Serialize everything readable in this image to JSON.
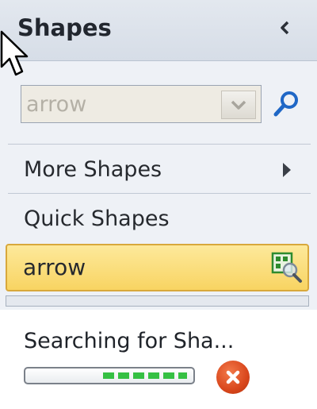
{
  "pane": {
    "title": "Shapes",
    "collapse_icon": "chevron-left-icon"
  },
  "search": {
    "value": "arrow",
    "dropdown_icon": "chevron-down-icon",
    "button_icon": "search-icon"
  },
  "menu": {
    "more_shapes": "More Shapes",
    "quick_shapes": "Quick Shapes"
  },
  "selected_stencil": {
    "label": "arrow",
    "icon": "stencil-search-icon"
  },
  "status": {
    "text": "Searching for Sha...",
    "progress": 0.5,
    "cancel_icon": "close-icon"
  },
  "colors": {
    "accent": "#1f67c6",
    "progress_green": "#35c043",
    "selected_bg": "#f8d462",
    "cancel_red": "#d9471c"
  }
}
